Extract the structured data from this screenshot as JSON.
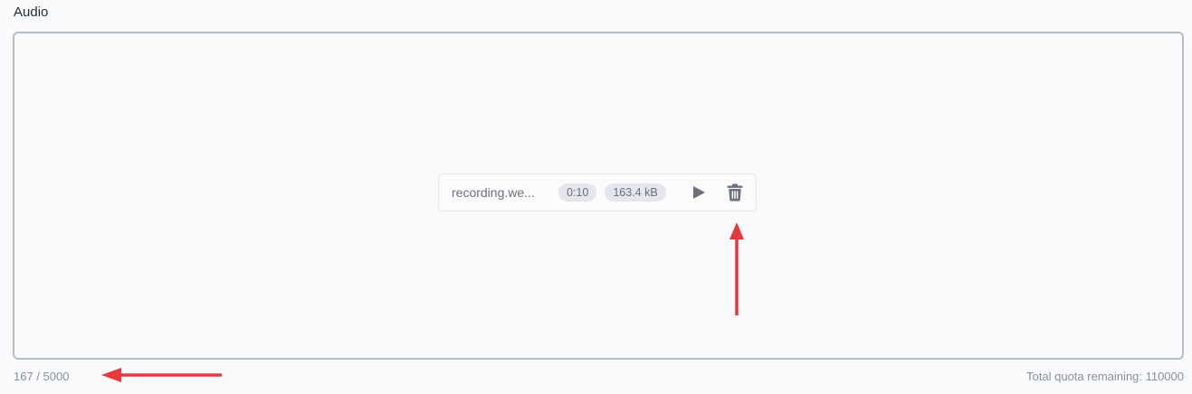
{
  "field": {
    "label": "Audio"
  },
  "file": {
    "name": "recording.we...",
    "duration": "0:10",
    "size": "163.4 kB",
    "play_icon": "play-icon",
    "delete_icon": "trash-icon"
  },
  "footer": {
    "char_count": "167 / 5000",
    "quota": "Total quota remaining: 110000"
  },
  "annotations": {
    "arrow_color": "#e5393d"
  },
  "colors": {
    "border": "#b9bcc8",
    "chip_bg": "#e4e6eb",
    "icon": "#6b6f7e"
  }
}
